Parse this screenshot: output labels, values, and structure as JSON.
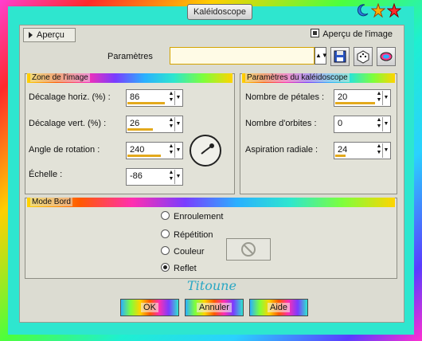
{
  "window": {
    "title": "Kaléidoscope"
  },
  "header": {
    "preview_toggle_label": "Aperçu",
    "preview_checkbox_label": "Aperçu de l'image",
    "preview_checked": true,
    "params_label": "Paramètres",
    "params_value": ""
  },
  "zone": {
    "title": "Zone de l'image",
    "fields": [
      {
        "label": "Décalage horiz. (%) :",
        "value": "86",
        "level_pct": 93
      },
      {
        "label": "Décalage vert. (%) :",
        "value": "26",
        "level_pct": 63
      },
      {
        "label": "Angle de rotation :",
        "value": "240",
        "level_pct": 83
      },
      {
        "label": "Échelle :",
        "value": "-86",
        "level_pct": 0
      }
    ]
  },
  "kaleido": {
    "title": "Paramètres du kaléidoscope",
    "fields": [
      {
        "label": "Nombre de pétales :",
        "value": "20",
        "level_pct": 100
      },
      {
        "label": "Nombre d'orbites :",
        "value": "0",
        "level_pct": 0
      },
      {
        "label": "Aspiration radiale :",
        "value": "24",
        "level_pct": 25
      }
    ]
  },
  "edge": {
    "title": "Mode Bord",
    "options": [
      {
        "label": "Enroulement",
        "selected": false
      },
      {
        "label": "Répétition",
        "selected": false
      },
      {
        "label": "Couleur",
        "selected": false
      },
      {
        "label": "Reflet",
        "selected": true
      }
    ]
  },
  "signature": "Titoune",
  "buttons": {
    "ok": "OK",
    "cancel": "Annuler",
    "help": "Aide"
  },
  "colors": {
    "accent": "#e3a91c",
    "frame": "#2ee6cf",
    "panel": "#dcdcd2"
  }
}
